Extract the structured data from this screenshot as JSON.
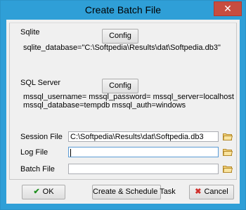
{
  "window": {
    "title": "Create Batch File",
    "close": "✕"
  },
  "sqlite": {
    "label": "Sqlite",
    "config_button": "Config",
    "info": "sqlite_database=\"C:\\Softpedia\\Results\\dat\\Softpedia.db3\""
  },
  "sqlserver": {
    "label": "SQL Server",
    "config_button": "Config",
    "info_line1": "mssql_username= mssql_password= mssql_server=localhost",
    "info_line2": "mssql_database=tempdb mssql_auth=windows"
  },
  "fields": {
    "session_label": "Session File",
    "session_value": "C:\\Softpedia\\Results\\dat\\Softpedia.db3",
    "log_label": "Log File",
    "log_value": "",
    "batch_label": "Batch File",
    "batch_value": ""
  },
  "buttons": {
    "ok": "OK",
    "create_schedule": "Create & Schedule Task",
    "cancel": "Cancel"
  },
  "icons": {
    "folder": "folder-open-icon",
    "ok": "checkmark-icon",
    "cancel": "cross-icon"
  }
}
